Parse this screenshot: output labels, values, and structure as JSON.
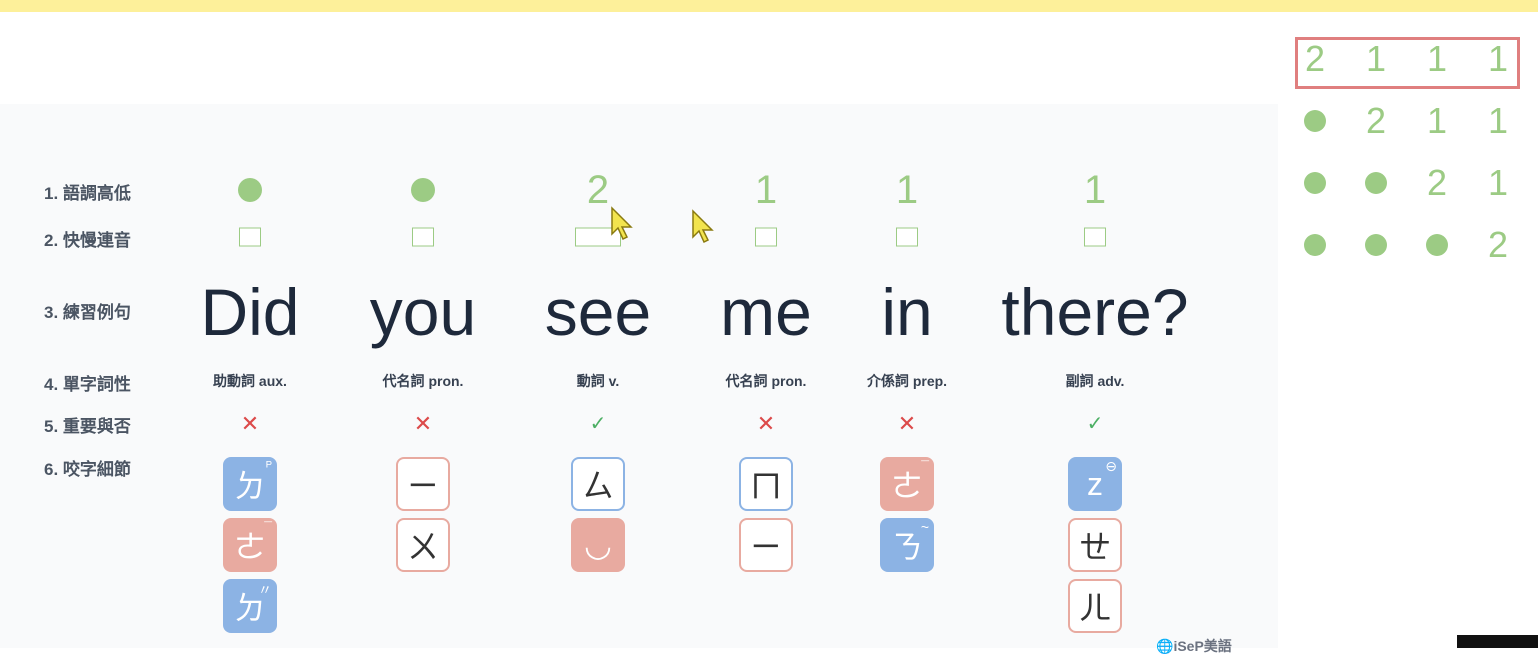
{
  "row_labels": [
    "1. 語調高低",
    "2. 快慢連音",
    "3. 練習例句",
    "4. 單字詞性",
    "5. 重要與否",
    "6. 咬字細節"
  ],
  "words": [
    {
      "text": "Did",
      "pos": "助動詞 aux.",
      "tone": "dot",
      "important": false,
      "tiles": [
        {
          "char": "ㄉ",
          "style": "blue",
          "sup": "ᴾ"
        },
        {
          "char": "ㄜ",
          "style": "pink",
          "sup": "¯"
        },
        {
          "char": "ㄉ",
          "style": "blue",
          "sup": "〃"
        }
      ]
    },
    {
      "text": "you",
      "pos": "代名詞 pron.",
      "tone": "dot",
      "important": false,
      "tiles": [
        {
          "char": "ㄧ",
          "style": "out-pink",
          "sup": ""
        },
        {
          "char": "ㄨ",
          "style": "out-pink",
          "sup": ""
        }
      ]
    },
    {
      "text": "see",
      "pos": "動詞 v.",
      "tone": "2",
      "important": true,
      "tiles": [
        {
          "char": "ㄙ",
          "style": "out-blue",
          "sup": ""
        },
        {
          "char": "◡",
          "style": "pink",
          "sup": ""
        }
      ]
    },
    {
      "text": "me",
      "pos": "代名詞 pron.",
      "tone": "1",
      "important": false,
      "tiles": [
        {
          "char": "ㄇ",
          "style": "out-blue",
          "sup": ""
        },
        {
          "char": "ㄧ",
          "style": "out-pink",
          "sup": ""
        }
      ]
    },
    {
      "text": "in",
      "pos": "介係詞 prep.",
      "tone": "1",
      "important": false,
      "tiles": [
        {
          "char": "ㄜ",
          "style": "pink",
          "sup": "¯"
        },
        {
          "char": "ㄋ",
          "style": "blue",
          "sup": "~"
        }
      ]
    },
    {
      "text": "there?",
      "pos": "副詞 adv.",
      "tone": "1",
      "important": true,
      "tiles": [
        {
          "char": "z",
          "style": "blue",
          "sup": "⊖"
        },
        {
          "char": "ㄝ",
          "style": "out-pink",
          "sup": ""
        },
        {
          "char": "ㄦ",
          "style": "out-pink",
          "sup": ""
        }
      ]
    }
  ],
  "marks": {
    "yes": "✓",
    "no": "✕"
  },
  "tone_pattern": [
    [
      "2",
      "1",
      "1",
      "1"
    ],
    [
      "dot",
      "2",
      "1",
      "1"
    ],
    [
      "dot",
      "dot",
      "2",
      "1"
    ],
    [
      "dot",
      "dot",
      "dot",
      "2"
    ]
  ],
  "logo_text": "iSeP美語",
  "colors": {
    "accent_green": "#9ccb84",
    "highlight_red": "#e07f7f",
    "tile_blue": "#8cb3e4",
    "tile_pink": "#e8aaa0"
  }
}
